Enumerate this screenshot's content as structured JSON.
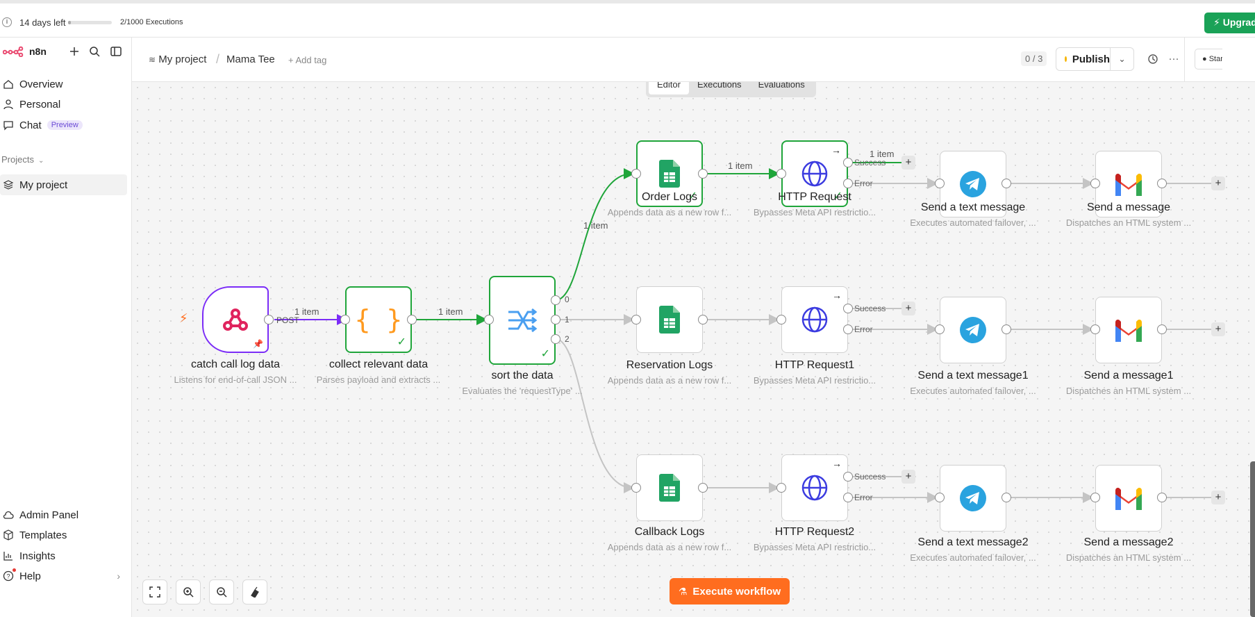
{
  "trial": {
    "days_left": "14 days left",
    "executions": "2/1000 Executions",
    "progress_fraction": 0.002,
    "upgrade_label": "Upgrade"
  },
  "sidebar": {
    "brand": "n8n",
    "items": [
      {
        "label": "Overview",
        "icon": "home-icon"
      },
      {
        "label": "Personal",
        "icon": "user-icon"
      },
      {
        "label": "Chat",
        "icon": "chat-icon",
        "badge": "Preview"
      }
    ],
    "projects_label": "Projects",
    "project_item": "My project",
    "bottom_items": [
      {
        "label": "Admin Panel",
        "icon": "cloud-icon"
      },
      {
        "label": "Templates",
        "icon": "box-icon"
      },
      {
        "label": "Insights",
        "icon": "bar-chart-icon"
      },
      {
        "label": "Help",
        "icon": "help-icon"
      }
    ]
  },
  "header": {
    "project": "My project",
    "workflow_name": "Mama Tee",
    "add_tag": "+ Add tag",
    "counter": "0 / 3",
    "publish_label": "Publish",
    "star_label": "Star"
  },
  "tabs": [
    "Editor",
    "Executions",
    "Evaluations"
  ],
  "nodes": {
    "catch": {
      "title": "catch call log data",
      "subtitle": "Listens for end-of-call JSON ..."
    },
    "collect": {
      "title": "collect relevant data",
      "subtitle": "Parses payload and extracts ..."
    },
    "sort": {
      "title": "sort the data",
      "subtitle": "Evaluates the 'requestType' ..."
    },
    "order_logs": {
      "title": "Order Logs",
      "subtitle": "Appends data as a new row f..."
    },
    "http1": {
      "title": "HTTP Request",
      "subtitle": "Bypasses Meta API restrictio..."
    },
    "tg1": {
      "title": "Send a text message",
      "subtitle": "Executes automated failover, ..."
    },
    "gm1": {
      "title": "Send a message",
      "subtitle": "Dispatches an HTML system ..."
    },
    "reservation_logs": {
      "title": "Reservation Logs",
      "subtitle": "Appends data as a new row f..."
    },
    "http2": {
      "title": "HTTP Request1",
      "subtitle": "Bypasses Meta API restrictio..."
    },
    "tg2": {
      "title": "Send a text message1",
      "subtitle": "Executes automated failover, ..."
    },
    "gm2": {
      "title": "Send a message1",
      "subtitle": "Dispatches an HTML system ..."
    },
    "callback_logs": {
      "title": "Callback Logs",
      "subtitle": "Appends data as a new row f..."
    },
    "http3": {
      "title": "HTTP Request2",
      "subtitle": "Bypasses Meta API restrictio..."
    },
    "tg3": {
      "title": "Send a text message2",
      "subtitle": "Executes automated failover, ..."
    },
    "gm3": {
      "title": "Send a message2",
      "subtitle": "Dispatches an HTML system ..."
    }
  },
  "edge_labels": {
    "post": "POST",
    "one_item": "1 item",
    "success": "Success",
    "error": "Error",
    "switch_outputs": [
      "0",
      "1",
      "2"
    ]
  },
  "execute_label": "Execute workflow",
  "colors": {
    "success_green": "#1fa53a",
    "trigger_purple": "#7b2cf7",
    "execute_orange": "#ff6d1f",
    "upgrade_green": "#1aa257",
    "telegram_blue": "#2aa3df",
    "http_blue": "#3c3ce0",
    "sheets_green": "#21a464"
  }
}
